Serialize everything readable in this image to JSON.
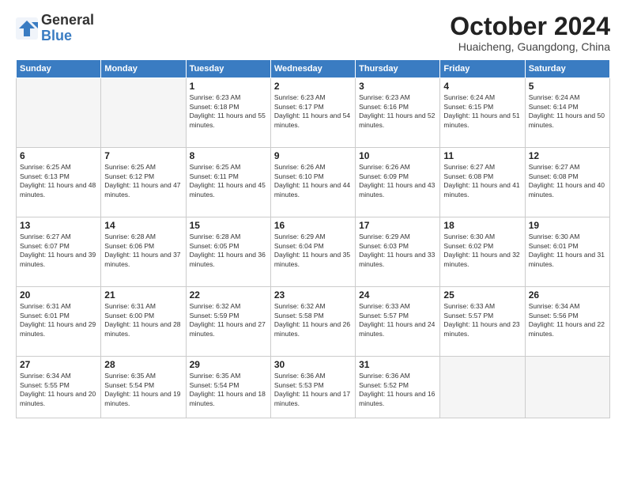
{
  "logo": {
    "general": "General",
    "blue": "Blue"
  },
  "title": "October 2024",
  "location": "Huaicheng, Guangdong, China",
  "days_header": [
    "Sunday",
    "Monday",
    "Tuesday",
    "Wednesday",
    "Thursday",
    "Friday",
    "Saturday"
  ],
  "weeks": [
    [
      {
        "day": "",
        "empty": true
      },
      {
        "day": "",
        "empty": true
      },
      {
        "day": "1",
        "sunrise": "Sunrise: 6:23 AM",
        "sunset": "Sunset: 6:18 PM",
        "daylight": "Daylight: 11 hours and 55 minutes."
      },
      {
        "day": "2",
        "sunrise": "Sunrise: 6:23 AM",
        "sunset": "Sunset: 6:17 PM",
        "daylight": "Daylight: 11 hours and 54 minutes."
      },
      {
        "day": "3",
        "sunrise": "Sunrise: 6:23 AM",
        "sunset": "Sunset: 6:16 PM",
        "daylight": "Daylight: 11 hours and 52 minutes."
      },
      {
        "day": "4",
        "sunrise": "Sunrise: 6:24 AM",
        "sunset": "Sunset: 6:15 PM",
        "daylight": "Daylight: 11 hours and 51 minutes."
      },
      {
        "day": "5",
        "sunrise": "Sunrise: 6:24 AM",
        "sunset": "Sunset: 6:14 PM",
        "daylight": "Daylight: 11 hours and 50 minutes."
      }
    ],
    [
      {
        "day": "6",
        "sunrise": "Sunrise: 6:25 AM",
        "sunset": "Sunset: 6:13 PM",
        "daylight": "Daylight: 11 hours and 48 minutes."
      },
      {
        "day": "7",
        "sunrise": "Sunrise: 6:25 AM",
        "sunset": "Sunset: 6:12 PM",
        "daylight": "Daylight: 11 hours and 47 minutes."
      },
      {
        "day": "8",
        "sunrise": "Sunrise: 6:25 AM",
        "sunset": "Sunset: 6:11 PM",
        "daylight": "Daylight: 11 hours and 45 minutes."
      },
      {
        "day": "9",
        "sunrise": "Sunrise: 6:26 AM",
        "sunset": "Sunset: 6:10 PM",
        "daylight": "Daylight: 11 hours and 44 minutes."
      },
      {
        "day": "10",
        "sunrise": "Sunrise: 6:26 AM",
        "sunset": "Sunset: 6:09 PM",
        "daylight": "Daylight: 11 hours and 43 minutes."
      },
      {
        "day": "11",
        "sunrise": "Sunrise: 6:27 AM",
        "sunset": "Sunset: 6:08 PM",
        "daylight": "Daylight: 11 hours and 41 minutes."
      },
      {
        "day": "12",
        "sunrise": "Sunrise: 6:27 AM",
        "sunset": "Sunset: 6:08 PM",
        "daylight": "Daylight: 11 hours and 40 minutes."
      }
    ],
    [
      {
        "day": "13",
        "sunrise": "Sunrise: 6:27 AM",
        "sunset": "Sunset: 6:07 PM",
        "daylight": "Daylight: 11 hours and 39 minutes."
      },
      {
        "day": "14",
        "sunrise": "Sunrise: 6:28 AM",
        "sunset": "Sunset: 6:06 PM",
        "daylight": "Daylight: 11 hours and 37 minutes."
      },
      {
        "day": "15",
        "sunrise": "Sunrise: 6:28 AM",
        "sunset": "Sunset: 6:05 PM",
        "daylight": "Daylight: 11 hours and 36 minutes."
      },
      {
        "day": "16",
        "sunrise": "Sunrise: 6:29 AM",
        "sunset": "Sunset: 6:04 PM",
        "daylight": "Daylight: 11 hours and 35 minutes."
      },
      {
        "day": "17",
        "sunrise": "Sunrise: 6:29 AM",
        "sunset": "Sunset: 6:03 PM",
        "daylight": "Daylight: 11 hours and 33 minutes."
      },
      {
        "day": "18",
        "sunrise": "Sunrise: 6:30 AM",
        "sunset": "Sunset: 6:02 PM",
        "daylight": "Daylight: 11 hours and 32 minutes."
      },
      {
        "day": "19",
        "sunrise": "Sunrise: 6:30 AM",
        "sunset": "Sunset: 6:01 PM",
        "daylight": "Daylight: 11 hours and 31 minutes."
      }
    ],
    [
      {
        "day": "20",
        "sunrise": "Sunrise: 6:31 AM",
        "sunset": "Sunset: 6:01 PM",
        "daylight": "Daylight: 11 hours and 29 minutes."
      },
      {
        "day": "21",
        "sunrise": "Sunrise: 6:31 AM",
        "sunset": "Sunset: 6:00 PM",
        "daylight": "Daylight: 11 hours and 28 minutes."
      },
      {
        "day": "22",
        "sunrise": "Sunrise: 6:32 AM",
        "sunset": "Sunset: 5:59 PM",
        "daylight": "Daylight: 11 hours and 27 minutes."
      },
      {
        "day": "23",
        "sunrise": "Sunrise: 6:32 AM",
        "sunset": "Sunset: 5:58 PM",
        "daylight": "Daylight: 11 hours and 26 minutes."
      },
      {
        "day": "24",
        "sunrise": "Sunrise: 6:33 AM",
        "sunset": "Sunset: 5:57 PM",
        "daylight": "Daylight: 11 hours and 24 minutes."
      },
      {
        "day": "25",
        "sunrise": "Sunrise: 6:33 AM",
        "sunset": "Sunset: 5:57 PM",
        "daylight": "Daylight: 11 hours and 23 minutes."
      },
      {
        "day": "26",
        "sunrise": "Sunrise: 6:34 AM",
        "sunset": "Sunset: 5:56 PM",
        "daylight": "Daylight: 11 hours and 22 minutes."
      }
    ],
    [
      {
        "day": "27",
        "sunrise": "Sunrise: 6:34 AM",
        "sunset": "Sunset: 5:55 PM",
        "daylight": "Daylight: 11 hours and 20 minutes."
      },
      {
        "day": "28",
        "sunrise": "Sunrise: 6:35 AM",
        "sunset": "Sunset: 5:54 PM",
        "daylight": "Daylight: 11 hours and 19 minutes."
      },
      {
        "day": "29",
        "sunrise": "Sunrise: 6:35 AM",
        "sunset": "Sunset: 5:54 PM",
        "daylight": "Daylight: 11 hours and 18 minutes."
      },
      {
        "day": "30",
        "sunrise": "Sunrise: 6:36 AM",
        "sunset": "Sunset: 5:53 PM",
        "daylight": "Daylight: 11 hours and 17 minutes."
      },
      {
        "day": "31",
        "sunrise": "Sunrise: 6:36 AM",
        "sunset": "Sunset: 5:52 PM",
        "daylight": "Daylight: 11 hours and 16 minutes."
      },
      {
        "day": "",
        "empty": true
      },
      {
        "day": "",
        "empty": true
      }
    ]
  ]
}
